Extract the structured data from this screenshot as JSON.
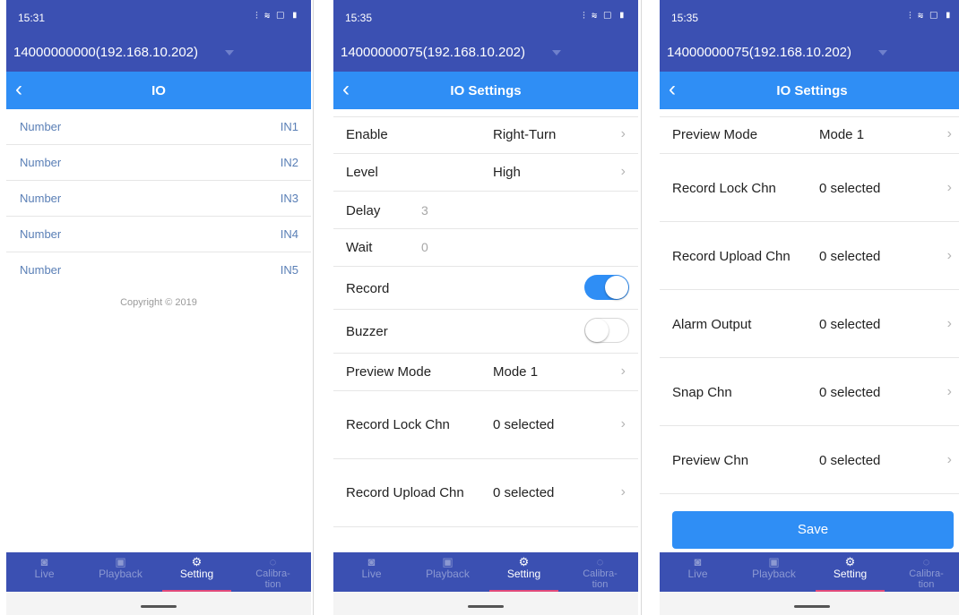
{
  "status": {
    "icons": "⫶ ≋ ▢ ▮",
    "screens": [
      {
        "time": "15:31"
      },
      {
        "time": "15:35"
      },
      {
        "time": "15:35"
      }
    ]
  },
  "screen1": {
    "device": "14000000000(192.168.10.202)",
    "title": "IO",
    "rows": [
      {
        "label": "Number",
        "value": "IN1"
      },
      {
        "label": "Number",
        "value": "IN2"
      },
      {
        "label": "Number",
        "value": "IN3"
      },
      {
        "label": "Number",
        "value": "IN4"
      },
      {
        "label": "Number",
        "value": "IN5"
      }
    ],
    "copyright": "Copyright © 2019"
  },
  "screen2": {
    "device": "14000000075(192.168.10.202)",
    "title": "IO Settings",
    "enable": {
      "label": "Enable",
      "value": "Right-Turn"
    },
    "level": {
      "label": "Level",
      "value": "High"
    },
    "delay": {
      "label": "Delay",
      "value": "3"
    },
    "wait": {
      "label": "Wait",
      "value": "0"
    },
    "record": {
      "label": "Record",
      "on": true
    },
    "buzzer": {
      "label": "Buzzer",
      "on": false
    },
    "preview_mode": {
      "label": "Preview Mode",
      "value": "Mode 1"
    },
    "record_lock": {
      "label": "Record Lock Chn",
      "value": "0 selected"
    },
    "record_upload": {
      "label": "Record Upload Chn",
      "value": "0 selected"
    }
  },
  "screen3": {
    "device": "14000000075(192.168.10.202)",
    "title": "IO Settings",
    "rows": [
      {
        "label": "Preview Mode",
        "value": "Mode 1"
      },
      {
        "label": "Record Lock Chn",
        "value": "0 selected"
      },
      {
        "label": "Record Upload Chn",
        "value": "0 selected"
      },
      {
        "label": "Alarm Output",
        "value": "0 selected"
      },
      {
        "label": "Snap Chn",
        "value": "0 selected"
      },
      {
        "label": "Preview Chn",
        "value": "0 selected"
      }
    ],
    "save": "Save"
  },
  "tabs": [
    {
      "label": "Live",
      "icon": "camera-icon",
      "glyph": "◙"
    },
    {
      "label": "Playback",
      "icon": "image-icon",
      "glyph": "▣"
    },
    {
      "label": "Setting",
      "icon": "gear-icon",
      "glyph": "⚙",
      "active": true
    },
    {
      "label": "Calibra-\ntion",
      "icon": "calibration-icon",
      "glyph": "◌"
    }
  ],
  "colors": {
    "header": "#3b50b2",
    "navbar": "#2f8ef5",
    "accent": "#2f8ef5",
    "active_underline": "#e24a7a"
  }
}
